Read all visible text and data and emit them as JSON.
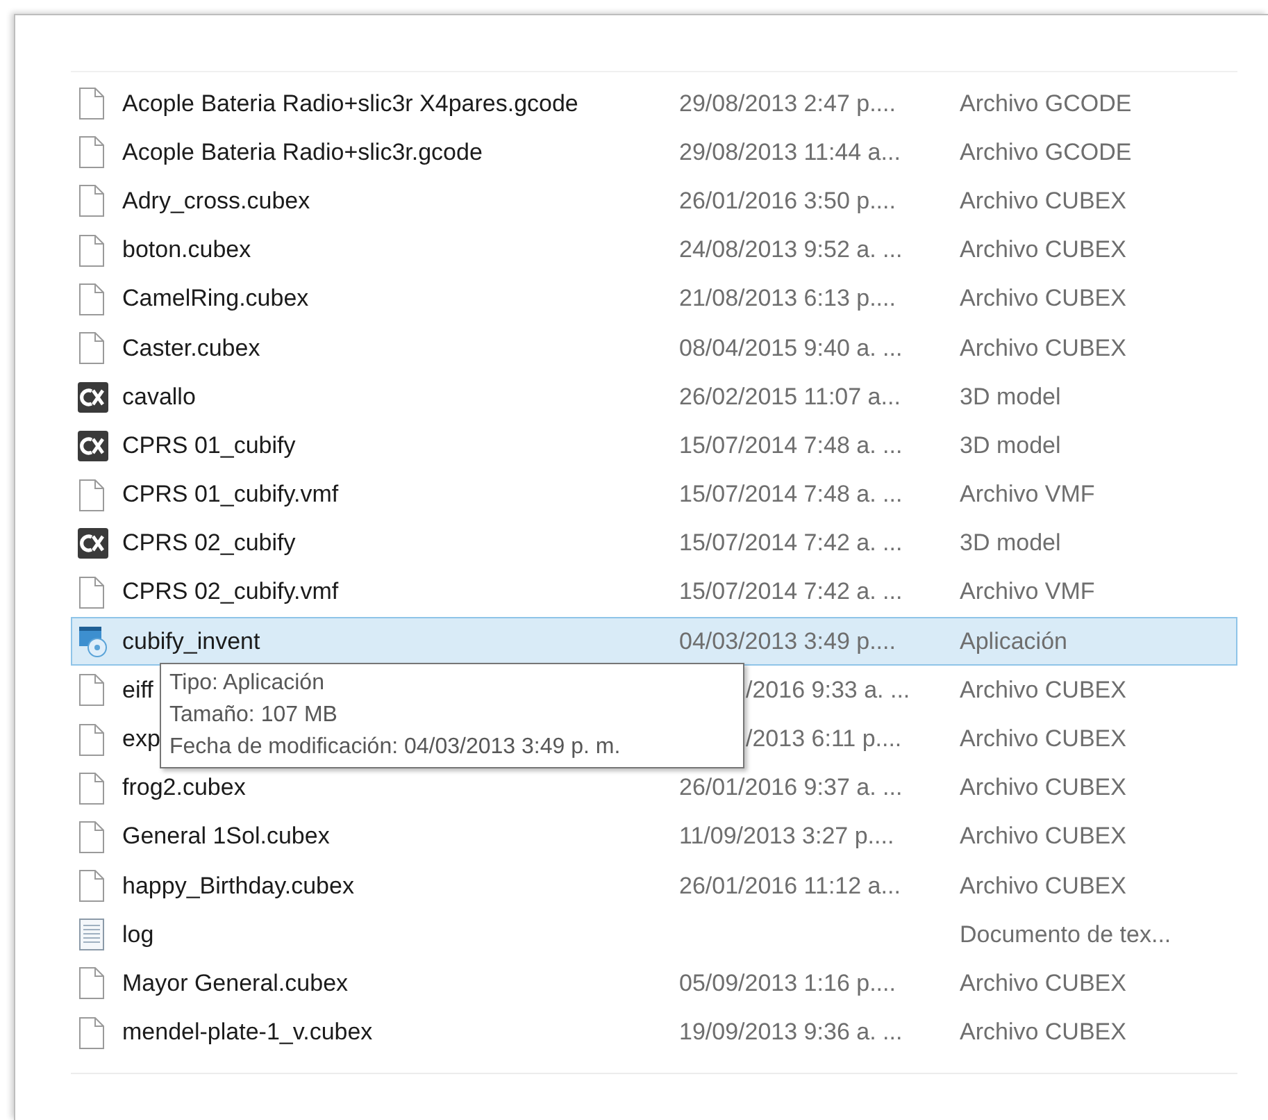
{
  "files": [
    {
      "kind": "file",
      "name": "Acople Bateria Radio+slic3r X4pares.gcode",
      "date": "29/08/2013 2:47 p....",
      "type": "Archivo GCODE",
      "selected": false
    },
    {
      "kind": "file",
      "name": "Acople Bateria Radio+slic3r.gcode",
      "date": "29/08/2013 11:44 a...",
      "type": "Archivo GCODE",
      "selected": false
    },
    {
      "kind": "file",
      "name": "Adry_cross.cubex",
      "date": "26/01/2016 3:50 p....",
      "type": "Archivo CUBEX",
      "selected": false
    },
    {
      "kind": "file",
      "name": "boton.cubex",
      "date": "24/08/2013 9:52 a. ...",
      "type": "Archivo CUBEX",
      "selected": false
    },
    {
      "kind": "file",
      "name": "CamelRing.cubex",
      "date": "21/08/2013 6:13 p....",
      "type": "Archivo CUBEX",
      "selected": false
    },
    {
      "kind": "file",
      "name": "Caster.cubex",
      "date": "08/04/2015 9:40 a. ...",
      "type": "Archivo CUBEX",
      "selected": false
    },
    {
      "kind": "model",
      "name": "cavallo",
      "date": "26/02/2015 11:07 a...",
      "type": "3D model",
      "selected": false
    },
    {
      "kind": "model",
      "name": "CPRS 01_cubify",
      "date": "15/07/2014 7:48 a. ...",
      "type": "3D model",
      "selected": false
    },
    {
      "kind": "file",
      "name": "CPRS 01_cubify.vmf",
      "date": "15/07/2014 7:48 a. ...",
      "type": "Archivo VMF",
      "selected": false
    },
    {
      "kind": "model",
      "name": "CPRS 02_cubify",
      "date": "15/07/2014 7:42 a. ...",
      "type": "3D model",
      "selected": false
    },
    {
      "kind": "file",
      "name": "CPRS 02_cubify.vmf",
      "date": "15/07/2014 7:42 a. ...",
      "type": "Archivo VMF",
      "selected": false
    },
    {
      "kind": "app",
      "name": "cubify_invent",
      "date": "04/03/2013 3:49 p....",
      "type": "Aplicación",
      "selected": true
    },
    {
      "kind": "file",
      "name": "eiff",
      "date": "/2016 9:33 a. ...",
      "type": "Archivo CUBEX",
      "selected": false,
      "partial": true
    },
    {
      "kind": "file",
      "name": "exp",
      "date": "/2013 6:11 p....",
      "type": "Archivo CUBEX",
      "selected": false,
      "partial": true
    },
    {
      "kind": "file",
      "name": "frog2.cubex",
      "date": "26/01/2016 9:37 a. ...",
      "type": "Archivo CUBEX",
      "selected": false
    },
    {
      "kind": "file",
      "name": "General 1Sol.cubex",
      "date": "11/09/2013 3:27 p....",
      "type": "Archivo CUBEX",
      "selected": false
    },
    {
      "kind": "file",
      "name": "happy_Birthday.cubex",
      "date": "26/01/2016 11:12 a...",
      "type": "Archivo CUBEX",
      "selected": false
    },
    {
      "kind": "text",
      "name": "log",
      "type": "Documento de tex...",
      "selected": false
    },
    {
      "kind": "file",
      "name": "Mayor General.cubex",
      "date": "05/09/2013 1:16 p....",
      "type": "Archivo CUBEX",
      "selected": false
    },
    {
      "kind": "file",
      "name": "mendel-plate-1_v.cubex",
      "date": "19/09/2013 9:36 a. ...",
      "type": "Archivo CUBEX",
      "selected": false
    }
  ],
  "tooltip": {
    "lines": [
      "Tipo: Aplicación",
      "Tamaño: 107 MB",
      "Fecha de modificación: 04/03/2013 3:49 p. m."
    ]
  }
}
